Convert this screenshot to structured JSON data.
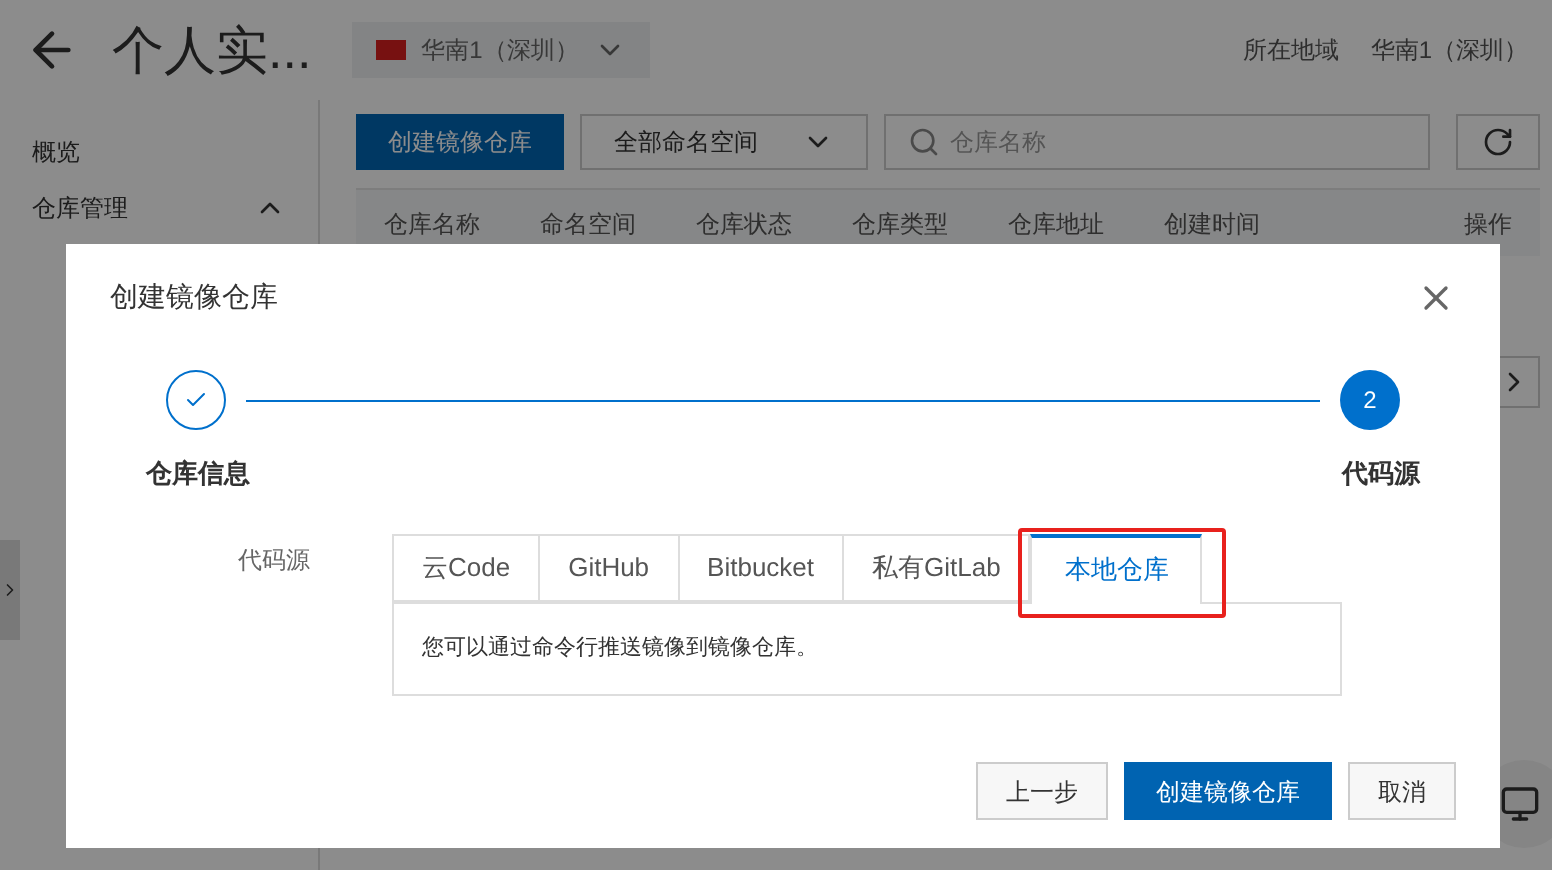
{
  "header": {
    "title": "个人实...",
    "region": "华南1（深圳）",
    "location_label": "所在地域",
    "location_value": "华南1（深圳）"
  },
  "sidebar": {
    "items": [
      {
        "label": "概览",
        "kind": "link"
      },
      {
        "label": "仓库管理",
        "kind": "group",
        "expanded": true
      }
    ]
  },
  "toolbar": {
    "create_button": "创建镜像仓库",
    "namespace_select": "全部命名空间",
    "search": {
      "placeholder": "仓库名称"
    }
  },
  "table": {
    "columns": [
      "仓库名称",
      "命名空间",
      "仓库状态",
      "仓库类型",
      "仓库地址",
      "创建时间",
      "操作"
    ]
  },
  "dialog": {
    "title": "创建镜像仓库",
    "steps": [
      {
        "label": "仓库信息",
        "done": true
      },
      {
        "label": "代码源",
        "number": "2",
        "done": false
      }
    ],
    "field_label": "代码源",
    "tabs": [
      {
        "label": "云Code",
        "selected": false
      },
      {
        "label": "GitHub",
        "selected": false
      },
      {
        "label": "Bitbucket",
        "selected": false
      },
      {
        "label": "私有GitLab",
        "selected": false
      },
      {
        "label": "本地仓库",
        "selected": true,
        "highlighted": true
      }
    ],
    "panel_text": "您可以通过命令行推送镜像到镜像仓库。",
    "buttons": [
      {
        "label": "上一步",
        "kind": "secondary"
      },
      {
        "label": "创建镜像仓库",
        "kind": "primary"
      },
      {
        "label": "取消",
        "kind": "secondary"
      }
    ]
  }
}
